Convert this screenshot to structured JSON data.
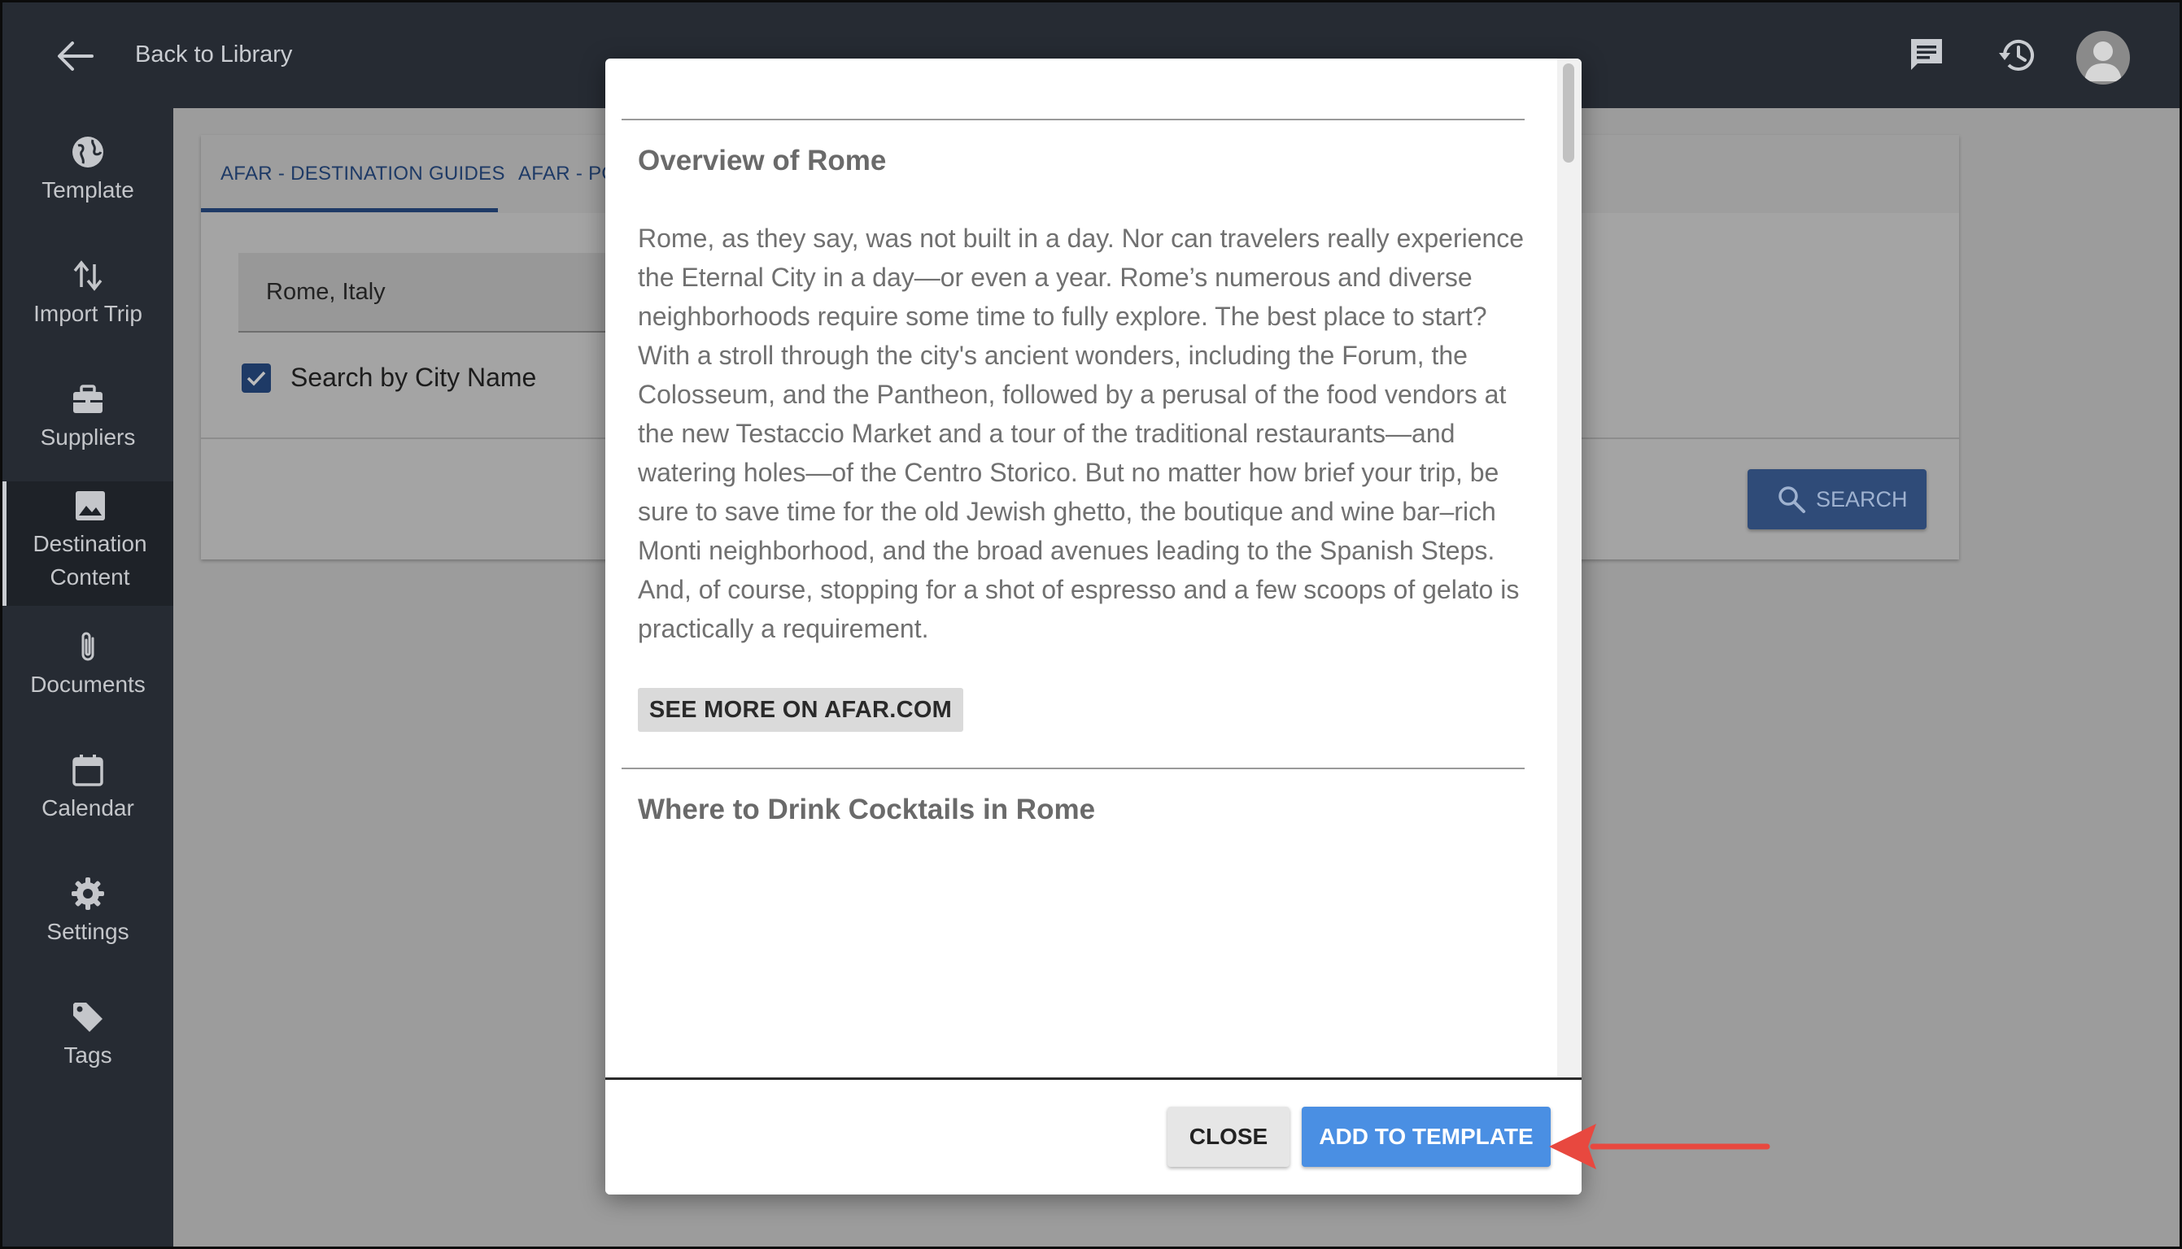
{
  "header": {
    "back_label": "Back to Library",
    "icons": [
      "back-arrow-icon",
      "chat-icon",
      "history-icon",
      "avatar"
    ]
  },
  "sidebar": {
    "items": [
      {
        "label": "Template",
        "icon": "globe-icon"
      },
      {
        "label": "Import Trip",
        "icon": "import-arrows-icon"
      },
      {
        "label": "Suppliers",
        "icon": "briefcase-icon"
      },
      {
        "label_line1": "Destination",
        "label_line2": "Content",
        "icon": "image-icon",
        "active": true
      },
      {
        "label": "Documents",
        "icon": "paperclip-icon"
      },
      {
        "label": "Calendar",
        "icon": "calendar-icon"
      },
      {
        "label": "Settings",
        "icon": "gear-icon"
      },
      {
        "label": "Tags",
        "icon": "tag-icon"
      }
    ]
  },
  "background": {
    "tabs": [
      "AFAR - DESTINATION GUIDES",
      "AFAR - PO"
    ],
    "city_value": "Rome, Italy",
    "checkbox_label": "Search by City Name",
    "checkbox_checked": true,
    "search_label": "SEARCH"
  },
  "modal": {
    "section1_title": "Overview of Rome",
    "section1_lines": [
      "Rome, as they say, was not built in a day. Nor can travelers really experience",
      "the Eternal City in a day—or even a year. Rome’s numerous and diverse",
      "neighborhoods require some time to fully explore. The best place to start?",
      "With a stroll through the city's ancient wonders, including the Forum, the",
      "Colosseum, and the Pantheon, followed by a perusal of the food vendors at",
      "the new Testaccio Market and a tour of the traditional restaurants—and",
      "watering holes—of the Centro Storico. But no matter how brief your trip, be",
      "sure to save time for the old Jewish ghetto, the boutique and wine bar–rich",
      "Monti neighborhood, and the broad avenues leading to the Spanish Steps.",
      "And, of course, stopping for a shot of espresso and a few scoops of gelato is",
      "practically a requirement."
    ],
    "see_more_label": "SEE MORE ON AFAR.COM",
    "section2_title": "Where to Drink Cocktails in Rome",
    "close_label": "CLOSE",
    "add_label": "ADD TO TEMPLATE"
  },
  "colors": {
    "sidebar_bg": "#262b33",
    "primary_button": "#4a8fe3",
    "annotation_arrow": "#e8483f",
    "tab_text": "#1e3a66"
  }
}
